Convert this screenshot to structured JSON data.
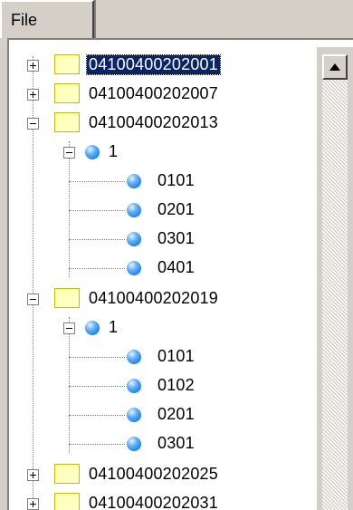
{
  "tabs": [
    {
      "label": "File"
    }
  ],
  "tree": [
    {
      "label": "04100400202001",
      "expanded": false,
      "selected": true
    },
    {
      "label": "04100400202007",
      "expanded": false,
      "selected": false
    },
    {
      "label": "04100400202013",
      "expanded": true,
      "selected": false,
      "child": {
        "label": "1",
        "children": [
          "0101",
          "0201",
          "0301",
          "0401"
        ]
      }
    },
    {
      "label": "04100400202019",
      "expanded": true,
      "selected": false,
      "child": {
        "label": "1",
        "children": [
          "0101",
          "0102",
          "0201",
          "0301"
        ]
      }
    },
    {
      "label": "04100400202025",
      "expanded": false,
      "selected": false
    },
    {
      "label": "04100400202031",
      "expanded": false,
      "selected": false
    }
  ],
  "scrollbar": {
    "up_icon": "up-arrow-icon"
  },
  "colors": {
    "selection": "#0a246a",
    "folder": "#ffffc0",
    "node_ball": "#1e76e8"
  }
}
